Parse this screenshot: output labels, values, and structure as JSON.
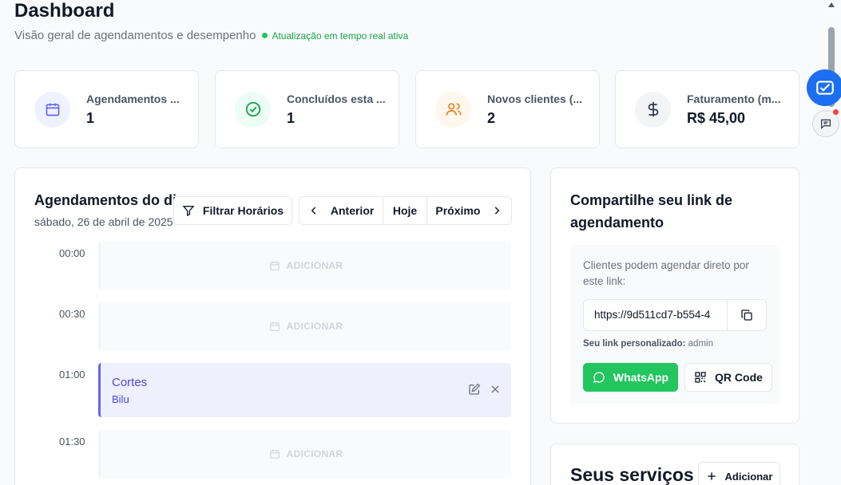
{
  "header": {
    "title": "Dashboard",
    "subtitle": "Visão geral de agendamentos e desempenho",
    "live_status": "Atualização em tempo real ativa"
  },
  "stats": [
    {
      "label": "Agendamentos ...",
      "value": "1",
      "icon": "calendar-icon",
      "color": "#6366f1",
      "bg": "#eef2ff"
    },
    {
      "label": "Concluídos esta ...",
      "value": "1",
      "icon": "check-circle-icon",
      "color": "#16a34a",
      "bg": "#ecfdf5"
    },
    {
      "label": "Novos clientes (...",
      "value": "2",
      "icon": "users-icon",
      "color": "#ea8a2a",
      "bg": "#fff7ed"
    },
    {
      "label": "Faturamento (m...",
      "value": "R$ 45,00",
      "icon": "dollar-icon",
      "color": "#374151",
      "bg": "#f3f4f6"
    }
  ],
  "schedule": {
    "title": "Agendamentos do dia",
    "date": "sábado, 26 de abril de 2025",
    "filter_label": "Filtrar Horários",
    "prev_label": "Anterior",
    "today_label": "Hoje",
    "next_label": "Próximo",
    "add_label": "ADICIONAR",
    "slots": [
      {
        "time": "00:00"
      },
      {
        "time": "00:30"
      },
      {
        "time": "01:00",
        "appointment": {
          "service": "Cortes",
          "client": "Bilu"
        }
      },
      {
        "time": "01:30"
      }
    ]
  },
  "share": {
    "title": "Compartilhe seu link de agendamento",
    "description": "Clientes podem agendar direto por este link:",
    "link": "https://9d511cd7-b554-4",
    "custom_prefix": "Seu link personalizado:",
    "custom_value": "admin",
    "whatsapp_label": "WhatsApp",
    "qr_label": "QR Code",
    "whatsapp_color": "#22c55e"
  },
  "services": {
    "title": "Seus serviços",
    "add_label": "Adicionar"
  }
}
